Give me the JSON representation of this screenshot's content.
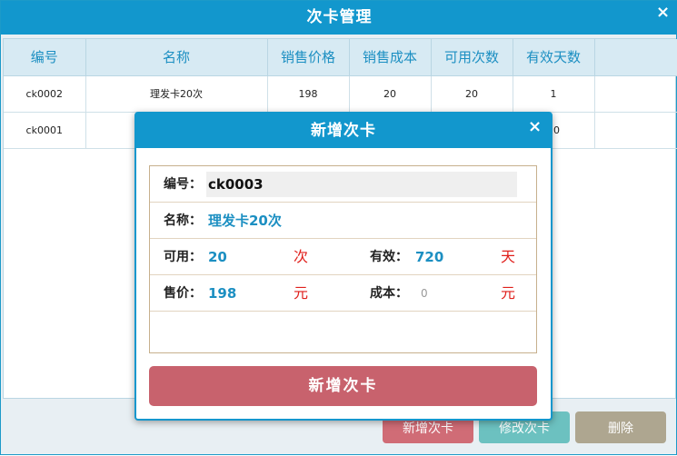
{
  "window": {
    "title": "次卡管理",
    "close_glyph": "×"
  },
  "table": {
    "headers": [
      "编号",
      "名称",
      "销售价格",
      "销售成本",
      "可用次数",
      "有效天数",
      ""
    ],
    "rows": [
      [
        "ck0002",
        "理发卡20次",
        "198",
        "20",
        "20",
        "1",
        ""
      ],
      [
        "ck0001",
        "",
        "",
        "",
        "",
        "20",
        ""
      ]
    ]
  },
  "toolbar": {
    "add_label": "新增次卡",
    "edit_label": "修改次卡",
    "delete_label": "删除"
  },
  "dialog": {
    "title": "新增次卡",
    "close_glyph": "×",
    "fields": {
      "code_label": "编号：",
      "code_value": "ck0003",
      "name_label": "名称：",
      "name_value": "理发卡20次",
      "uses_label": "可用：",
      "uses_value": "20",
      "uses_unit": "次",
      "days_label": "有效：",
      "days_value": "720",
      "days_unit": "天",
      "price_label": "售价：",
      "price_value": "198",
      "price_unit": "元",
      "cost_label": "成本：",
      "cost_value": "0",
      "cost_unit": "元"
    },
    "submit_label": "新增次卡"
  },
  "colors": {
    "primary": "#1297cd",
    "header_bg": "#d7eaf3",
    "accent_value": "#1c8fc2",
    "unit_red": "#e0201c",
    "btn_add": "#d06c76",
    "btn_edit": "#6cc1c0",
    "btn_delete": "#aea690"
  }
}
